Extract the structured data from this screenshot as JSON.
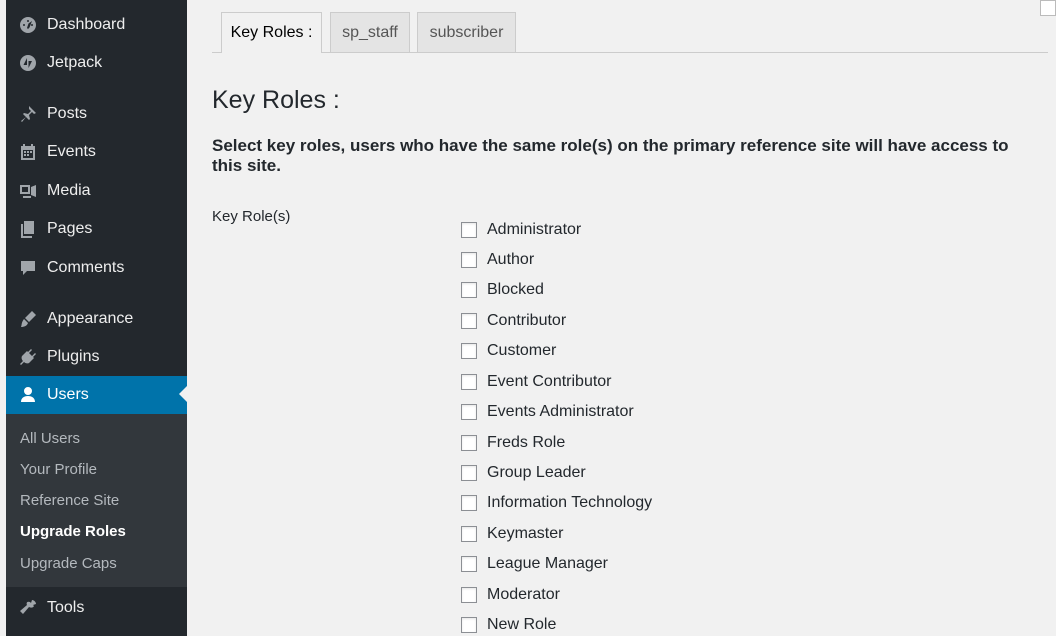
{
  "sidebar": {
    "items": [
      {
        "label": "Dashboard",
        "icon": "dashboard-icon"
      },
      {
        "label": "Jetpack",
        "icon": "jetpack-icon"
      },
      {
        "label": "Posts",
        "icon": "pin-icon"
      },
      {
        "label": "Events",
        "icon": "calendar-icon"
      },
      {
        "label": "Media",
        "icon": "media-icon"
      },
      {
        "label": "Pages",
        "icon": "pages-icon"
      },
      {
        "label": "Comments",
        "icon": "comment-icon"
      },
      {
        "label": "Appearance",
        "icon": "brush-icon"
      },
      {
        "label": "Plugins",
        "icon": "plugin-icon"
      },
      {
        "label": "Users",
        "icon": "user-icon"
      },
      {
        "label": "Tools",
        "icon": "wrench-icon"
      }
    ],
    "submenu": [
      "All Users",
      "Your Profile",
      "Reference Site",
      "Upgrade Roles",
      "Upgrade Caps"
    ],
    "accent_color": "#0073aa"
  },
  "tabs": [
    "Key Roles :",
    "sp_staff",
    "subscriber"
  ],
  "heading": "Key Roles :",
  "description": "Select key roles, users who have the same role(s) on the primary reference site will have access to this site.",
  "field_label": "Key Role(s)",
  "roles": [
    "Administrator",
    "Author",
    "Blocked",
    "Contributor",
    "Customer",
    "Event Contributor",
    "Events Administrator",
    "Freds Role",
    "Group Leader",
    "Information Technology",
    "Keymaster",
    "League Manager",
    "Moderator",
    "New Role"
  ]
}
